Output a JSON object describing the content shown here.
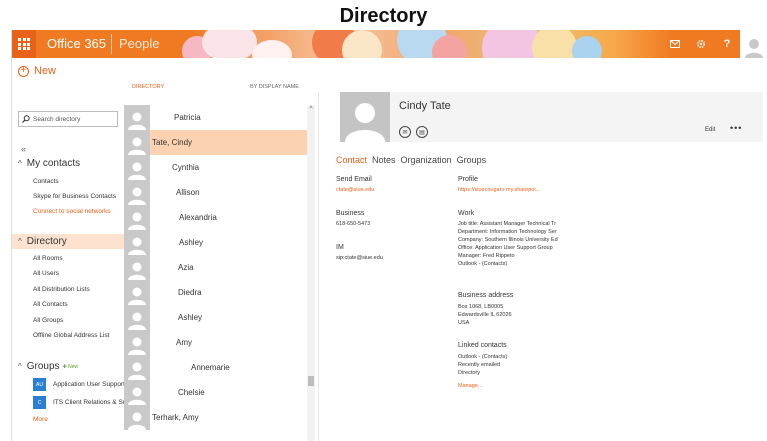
{
  "slide": {
    "title": "Directory"
  },
  "topbar": {
    "app_name": "Office 365",
    "section": "People",
    "icons": [
      "mail-icon",
      "gear-icon",
      "help-icon"
    ],
    "help_label": "?",
    "accent": "#f07a22"
  },
  "leftnav": {
    "new_label": "New",
    "search_placeholder": "Search directory",
    "collapse_label": "«",
    "my_contacts": {
      "heading": "My contacts",
      "items": [
        "Contacts",
        "Skype for Business Contacts"
      ],
      "link": "Connect to social networks"
    },
    "directory": {
      "heading": "Directory",
      "items": [
        "All Rooms",
        "All Users",
        "All Distribution Lists",
        "All Contacts",
        "All Groups",
        "Offline Global Address List"
      ]
    },
    "groups": {
      "heading": "Groups",
      "new_badge": "New",
      "items": [
        {
          "icon_text": "AU",
          "label": "Application User Support"
        },
        {
          "icon_text": "C",
          "label": "ITS Client Relations & Su"
        }
      ],
      "more_label": "More"
    }
  },
  "list": {
    "header_left": "DIRECTORY",
    "header_right": "BY DISPLAY NAME",
    "rows": [
      {
        "name": "Patricia",
        "selected": false
      },
      {
        "name": "Tate, Cindy",
        "selected": true
      },
      {
        "name": "Cynthia",
        "selected": false
      },
      {
        "name": "Allison",
        "selected": false
      },
      {
        "name": "Alexandria",
        "selected": false
      },
      {
        "name": "Ashley",
        "selected": false
      },
      {
        "name": "Azia",
        "selected": false
      },
      {
        "name": "Diedra",
        "selected": false
      },
      {
        "name": "Ashley",
        "selected": false
      },
      {
        "name": "Amy",
        "selected": false
      },
      {
        "name": "Annemarie",
        "selected": false
      },
      {
        "name": "Chelsie",
        "selected": false
      },
      {
        "name": "Terhark, Amy",
        "selected": false
      }
    ]
  },
  "detail": {
    "name": "Cindy Tate",
    "edit_label": "Edit",
    "more_label": "•••",
    "tabs": [
      "Contact",
      "Notes",
      "Organization",
      "Groups"
    ],
    "send_email": {
      "label": "Send Email",
      "value": "ctate@siue.edu"
    },
    "business": {
      "label": "Business",
      "value": "618-650-5473"
    },
    "im": {
      "label": "IM",
      "value": "sip:ctate@siue.edu"
    },
    "profile": {
      "label": "Profile",
      "value": "https://siuecougars-my.sharepoi..."
    },
    "work": {
      "label": "Work",
      "lines": [
        "Job title:  Assistant Manager Technical Tr",
        "Department:  Information Technology Ser",
        "Company:  Southern Illinois University Ed",
        "Office:  Application User Support Group",
        "Manager:  Fred Rippeto",
        "Outlook - (Contacts)"
      ]
    },
    "business_address": {
      "label": "Business address",
      "lines": [
        "Box 1068, LB0005",
        "Edwardsville IL 62026",
        "USA"
      ]
    },
    "linked_contacts": {
      "label": "Linked contacts",
      "lines": [
        "Outlook - (Contacts)",
        "Recently emailed",
        "Directory"
      ],
      "manage": "Manage..."
    }
  }
}
